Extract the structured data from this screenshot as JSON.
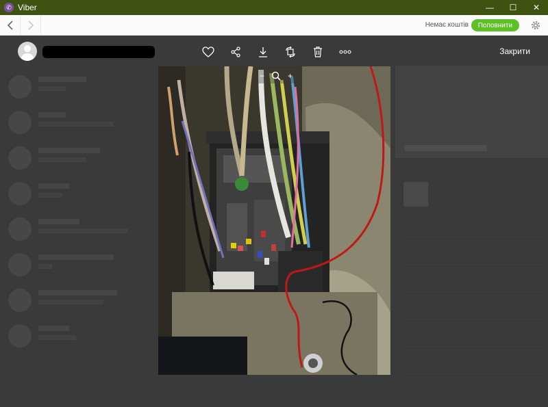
{
  "window": {
    "title": "Viber",
    "controls": [
      "—",
      "☐",
      "✕"
    ]
  },
  "toolbar": {
    "back_icon": "chevron-left-icon",
    "forward_icon": "chevron-right-icon",
    "balance_text": "Немає коштів",
    "topup_label": "Поповнити",
    "settings_icon": "gear-icon"
  },
  "viewer": {
    "close_label": "Закрити",
    "actions": [
      "heart-icon",
      "share-icon",
      "download-icon",
      "rotate-icon",
      "trash-icon",
      "more-icon"
    ],
    "zoom": {
      "minus": "−",
      "plus": "+"
    }
  },
  "colors": {
    "titlebar": "#3f5212",
    "accent": "#5ec026",
    "viber": "#7b519d"
  }
}
